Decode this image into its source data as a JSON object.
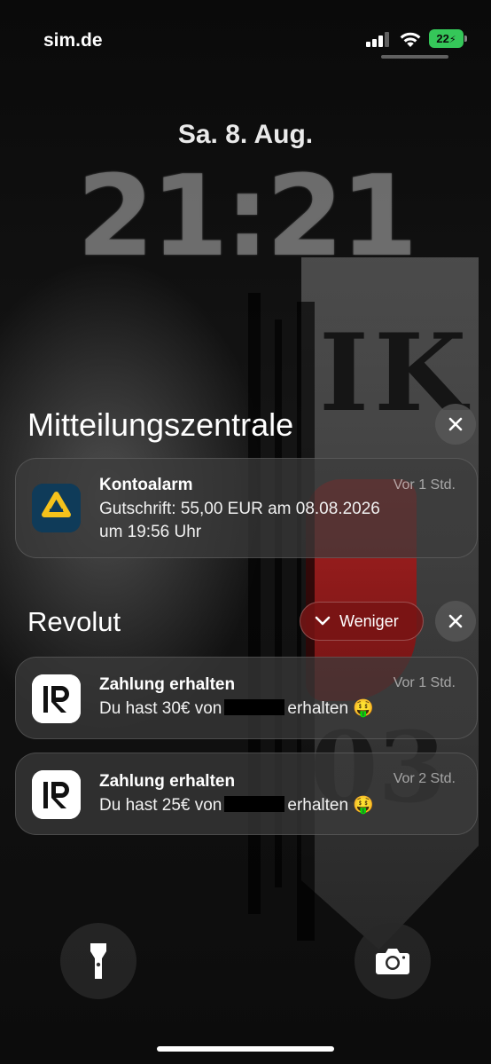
{
  "status_bar": {
    "carrier": "sim.de",
    "battery_level": "22",
    "battery_color": "#35c759"
  },
  "lockscreen": {
    "date": "Sa. 8. Aug.",
    "time": "21:21"
  },
  "notification_center": {
    "title": "Mitteilungszentrale",
    "clear_icon": "close-icon",
    "items": [
      {
        "app": "Kontoalarm",
        "time": "Vor 1 Std.",
        "body_line1": "Gutschrift: 55,00 EUR am 08.08.2026",
        "body_line2": "um 19:56 Uhr",
        "icon": "commerzbank-icon",
        "icon_colors": [
          "#0f3b59",
          "#f5c21b"
        ]
      }
    ]
  },
  "revolut_group": {
    "title": "Revolut",
    "collapse_label": "Weniger",
    "collapse_icon": "chevron-down-icon",
    "clear_icon": "close-icon",
    "items": [
      {
        "title": "Zahlung erhalten",
        "time": "Vor 1 Std.",
        "body_prefix": "Du hast 30€ von",
        "body_suffix": "erhalten 🤑",
        "icon": "revolut-icon"
      },
      {
        "title": "Zahlung erhalten",
        "time": "Vor 2 Std.",
        "body_prefix": "Du hast 25€ von",
        "body_suffix": "erhalten 🤑",
        "icon": "revolut-icon"
      }
    ]
  },
  "bottom_controls": {
    "left_icon": "flashlight-icon",
    "right_icon": "camera-icon"
  }
}
